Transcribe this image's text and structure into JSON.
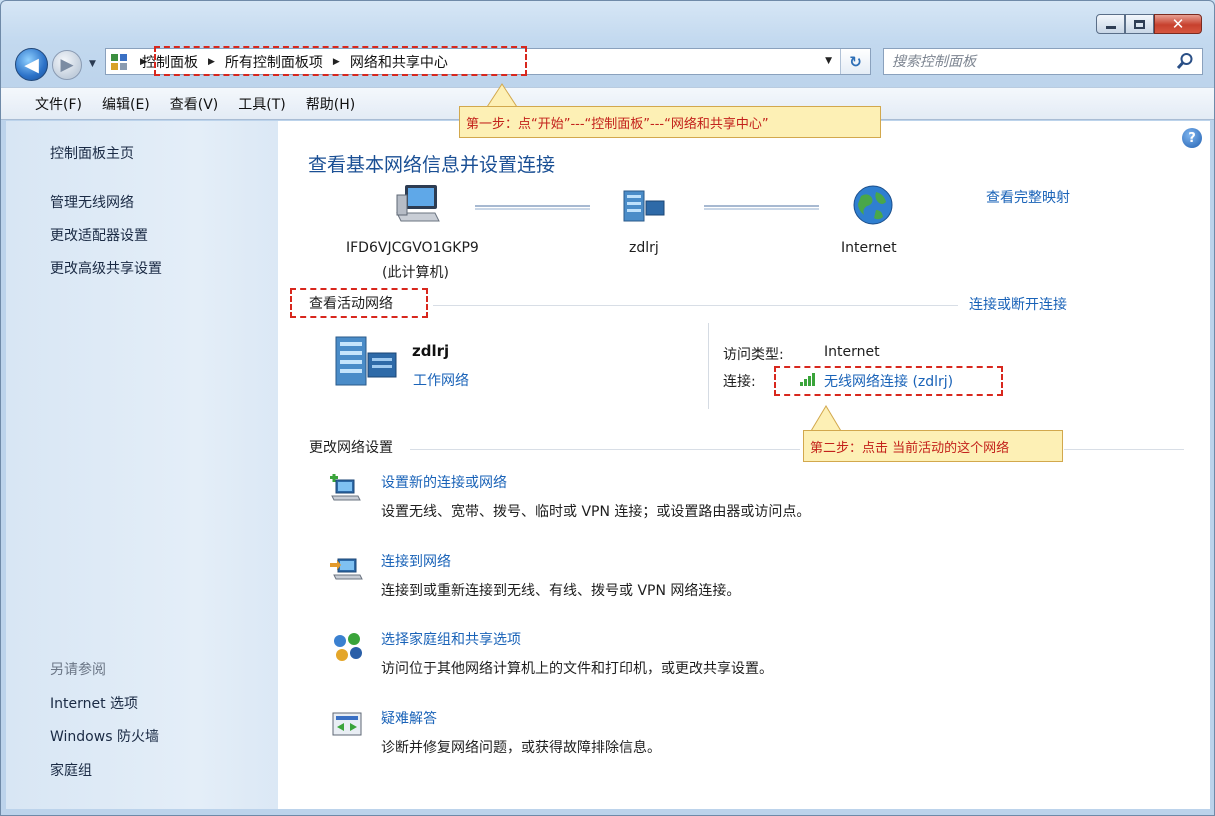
{
  "window": {
    "caption_buttons": [
      "minimize-icon",
      "maximize-icon",
      "close-icon"
    ]
  },
  "nav": {
    "back_glyph": "◀",
    "forward_glyph": "▶",
    "breadcrumbs": [
      "控制面板",
      "所有控制面板项",
      "网络和共享中心"
    ],
    "search_placeholder": "搜索控制面板",
    "refresh_glyph": "↻"
  },
  "menu": [
    "文件(F)",
    "编辑(E)",
    "查看(V)",
    "工具(T)",
    "帮助(H)"
  ],
  "sidebar": {
    "home": "控制面板主页",
    "links": [
      "管理无线网络",
      "更改适配器设置",
      "更改高级共享设置"
    ],
    "see_also_title": "另请参阅",
    "see_also": [
      "Internet 选项",
      "Windows 防火墙",
      "家庭组"
    ]
  },
  "main": {
    "help_glyph": "?",
    "title": "查看基本网络信息并设置连接",
    "map_link": "查看完整映射",
    "nodes": {
      "computer_name": "IFD6VJCGVO1GKP9",
      "computer_sub": "(此计算机)",
      "network": "zdlrj",
      "internet": "Internet"
    },
    "active_title": "查看活动网络",
    "connect_link": "连接或断开连接",
    "active_network": {
      "name": "zdlrj",
      "type": "工作网络",
      "access_label": "访问类型:",
      "access_value": "Internet",
      "conn_label": "连接:",
      "conn_value": "无线网络连接 (zdlrj)"
    },
    "change_title": "更改网络设置",
    "tasks": [
      {
        "icon": "new-connection-icon",
        "title": "设置新的连接或网络",
        "desc": "设置无线、宽带、拨号、临时或 VPN 连接；或设置路由器或访问点。"
      },
      {
        "icon": "connect-network-icon",
        "title": "连接到网络",
        "desc": "连接到或重新连接到无线、有线、拨号或 VPN 网络连接。"
      },
      {
        "icon": "homegroup-icon",
        "title": "选择家庭组和共享选项",
        "desc": "访问位于其他网络计算机上的文件和打印机，或更改共享设置。"
      },
      {
        "icon": "troubleshoot-icon",
        "title": "疑难解答",
        "desc": "诊断并修复网络问题，或获得故障排除信息。"
      }
    ]
  },
  "annotations": {
    "step1": "第一步：点“开始”---“控制面板”---“网络和共享中心”",
    "step2": "第二步：点击 当前活动的这个网络"
  },
  "colors": {
    "link": "#1a63b8",
    "title": "#1a4f94",
    "annotation": "#d8271d",
    "callout_bg": "#fdf0b5"
  }
}
